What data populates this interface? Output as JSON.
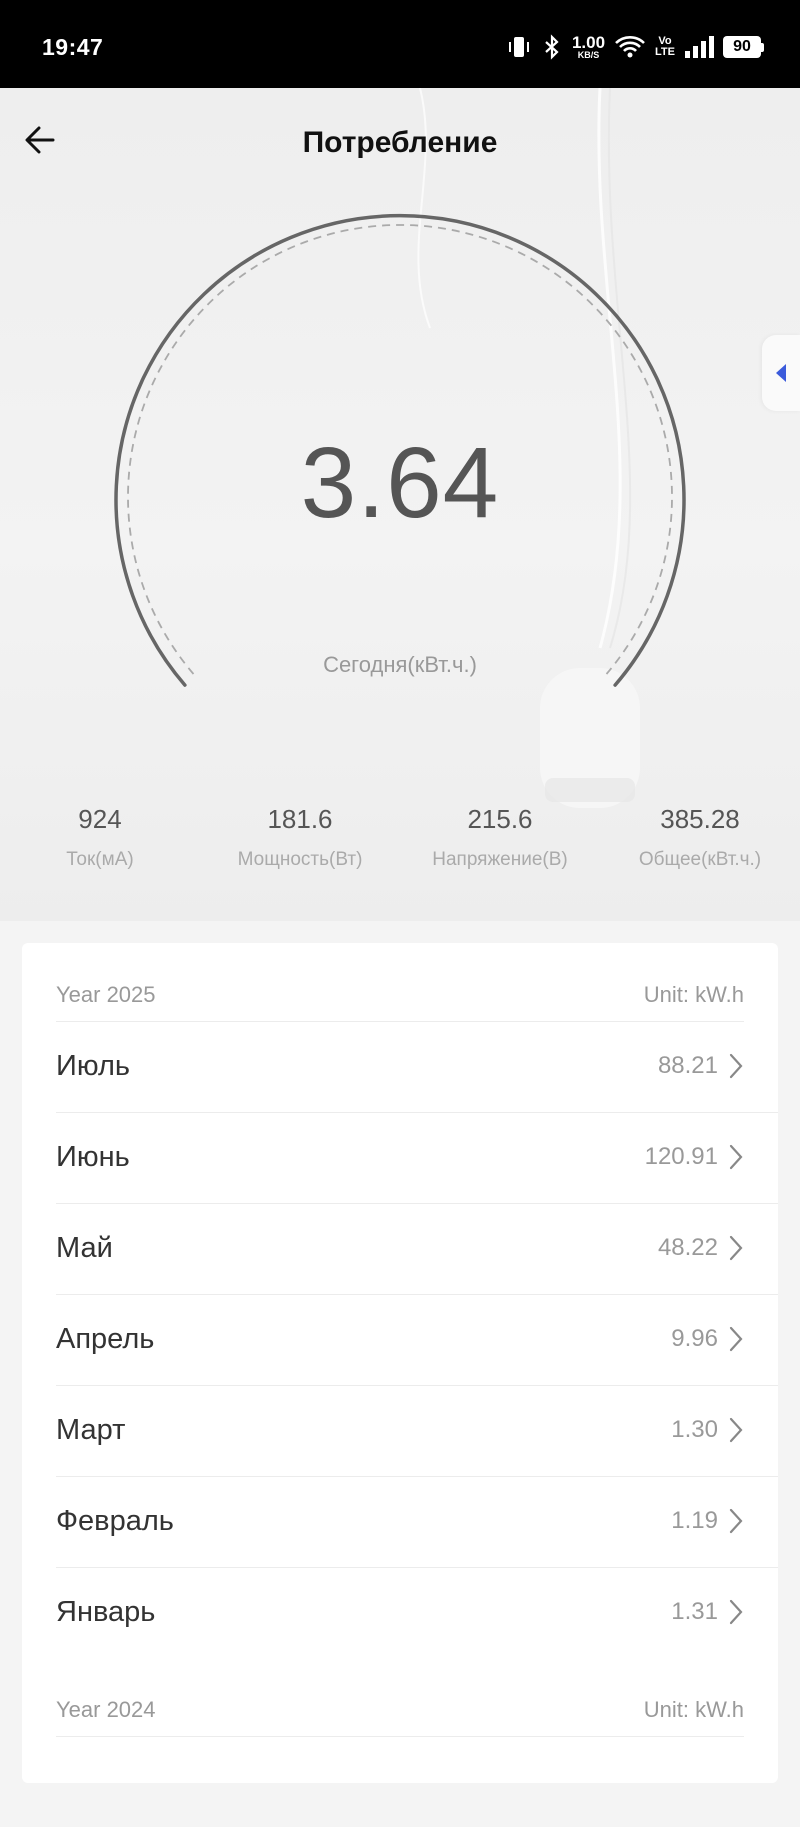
{
  "status_bar": {
    "time": "19:47",
    "net_speed": "1.00",
    "net_speed_unit": "KB/S",
    "volte_top": "Vo",
    "volte_bottom": "LTE",
    "battery": "90",
    "icons": [
      "vibrate-icon",
      "bluetooth-icon",
      "wifi-icon",
      "signal-icon",
      "battery-icon"
    ]
  },
  "header": {
    "title": "Потребление",
    "back_icon": "arrow-left-icon"
  },
  "gauge": {
    "value": "3.64",
    "label": "Сегодня(кВт.ч.)"
  },
  "stats": [
    {
      "value": "924",
      "label": "Ток(мА)"
    },
    {
      "value": "181.6",
      "label": "Мощность(Вт)"
    },
    {
      "value": "215.6",
      "label": "Напряжение(В)"
    },
    {
      "value": "385.28",
      "label": "Общее(кВт.ч.)"
    }
  ],
  "history": {
    "year_2025": {
      "year_label": "Year 2025",
      "unit_label": "Unit: kW.h",
      "months": [
        {
          "name": "Июль",
          "value": "88.21"
        },
        {
          "name": "Июнь",
          "value": "120.91"
        },
        {
          "name": "Май",
          "value": "48.22"
        },
        {
          "name": "Апрель",
          "value": "9.96"
        },
        {
          "name": "Март",
          "value": "1.30"
        },
        {
          "name": "Февраль",
          "value": "1.19"
        },
        {
          "name": "Январь",
          "value": "1.31"
        }
      ]
    },
    "year_2024": {
      "year_label": "Year 2024",
      "unit_label": "Unit: kW.h"
    }
  },
  "colors": {
    "accent": "#3b5bdb",
    "gauge_stroke": "#666666"
  }
}
